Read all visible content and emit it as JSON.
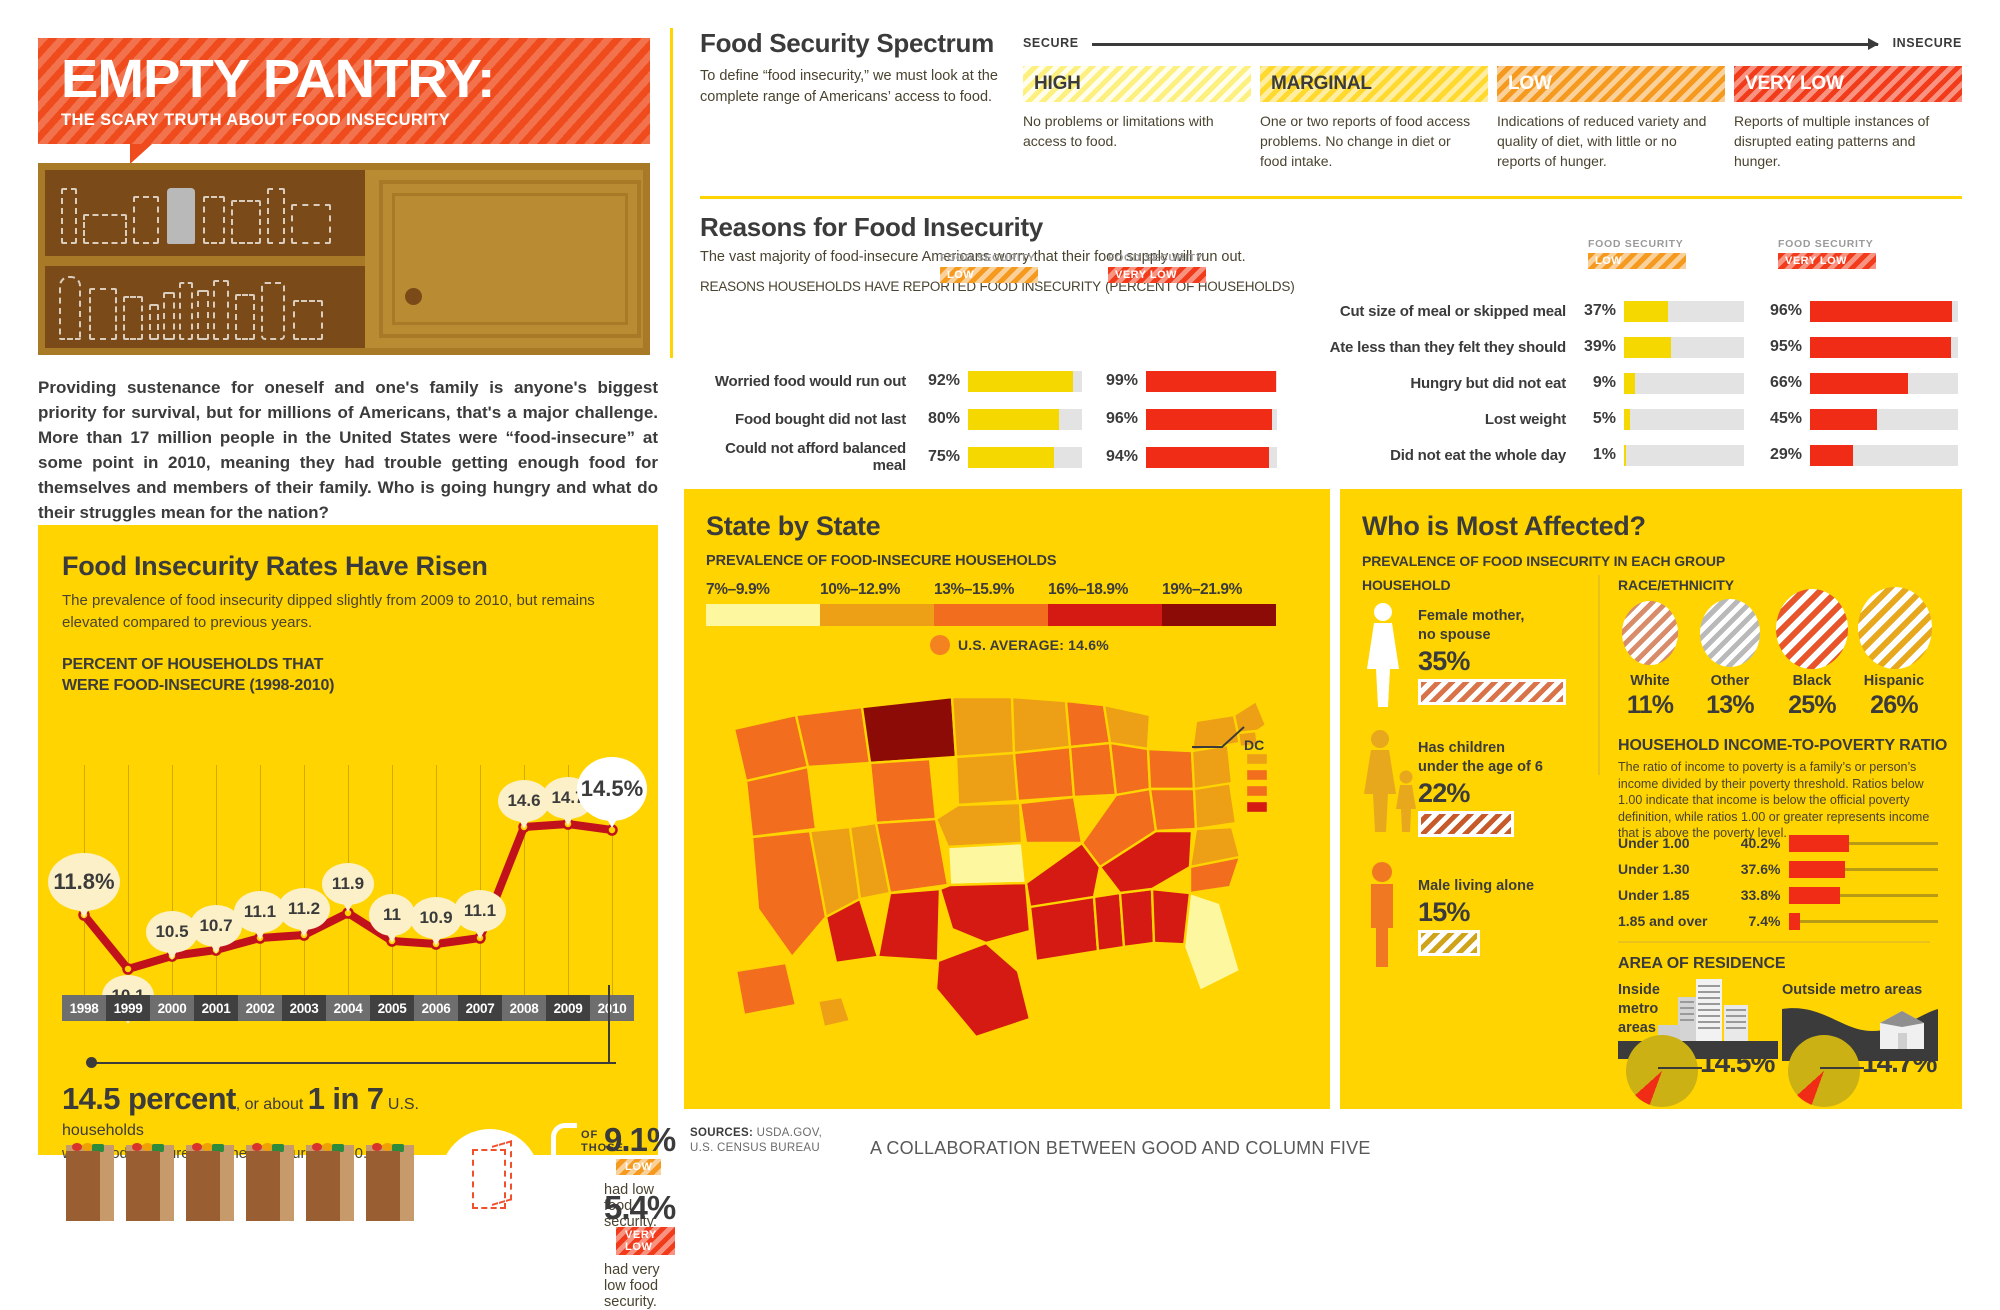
{
  "title": {
    "main": "EMPTY PANTRY:",
    "sub": "THE SCARY TRUTH ABOUT FOOD INSECURITY"
  },
  "intro": "Providing sustenance for oneself and one's family is anyone's biggest priority for survival, but for millions of Americans, that's a major challenge. More than 17 million people in the United States were “food-insecure” at some point in 2010, meaning they had trouble getting enough food for themselves and members of their family. Who is going hungry and what do their struggles mean for the nation?",
  "spectrum": {
    "heading": "Food Security Spectrum",
    "paragraph": "To define “food insecurity,” we must look at the complete range of Americans’ access to food.",
    "secure_label": "SECURE",
    "insecure_label": "INSECURE",
    "cells": [
      {
        "label": "HIGH",
        "desc": "No problems or limitations with access to food.",
        "style": "stripes-yellow-lt",
        "text": "dark"
      },
      {
        "label": "MARGINAL",
        "desc": "One or two reports of food access problems. No change in diet or food intake.",
        "style": "stripes-yellow",
        "text": "dark"
      },
      {
        "label": "LOW",
        "desc": "Indications of reduced variety and quality of diet, with little or no reports of hunger.",
        "style": "stripes-orange",
        "text": "light"
      },
      {
        "label": "VERY LOW",
        "desc": "Reports of multiple instances of disrupted eating patterns and hunger.",
        "style": "stripes-red",
        "text": "light"
      }
    ]
  },
  "reasons": {
    "heading": "Reasons for Food Insecurity",
    "paragraph": "The vast majority of food-insecure Americans worry that their food supply will run out.",
    "kicker": "REASONS HOUSEHOLDS HAVE REPORTED FOOD INSECURITY",
    "kicker_note": "(PERCENT OF HOUSEHOLDS)",
    "legend_caption": "FOOD SECURITY",
    "legend_low": "LOW",
    "legend_very_low": "VERY LOW",
    "left_rows": [
      {
        "label": "Worried food would run out",
        "low": "92%",
        "low_v": 92,
        "vlow": "99%",
        "vlow_v": 99
      },
      {
        "label": "Food bought did not last",
        "low": "80%",
        "low_v": 80,
        "vlow": "96%",
        "vlow_v": 96
      },
      {
        "label": "Could not afford balanced meal",
        "low": "75%",
        "low_v": 75,
        "vlow": "94%",
        "vlow_v": 94
      }
    ],
    "right_rows": [
      {
        "label": "Cut size of meal or skipped meal",
        "low": "37%",
        "low_v": 37,
        "vlow": "96%",
        "vlow_v": 96
      },
      {
        "label": "Ate less than they felt they should",
        "low": "39%",
        "low_v": 39,
        "vlow": "95%",
        "vlow_v": 95
      },
      {
        "label": "Hungry but did not eat",
        "low": "9%",
        "low_v": 9,
        "vlow": "66%",
        "vlow_v": 66
      },
      {
        "label": "Lost weight",
        "low": "5%",
        "low_v": 5,
        "vlow": "45%",
        "vlow_v": 45
      },
      {
        "label": "Did not eat the whole day",
        "low": "1%",
        "low_v": 1,
        "vlow": "29%",
        "vlow_v": 29
      }
    ]
  },
  "rates": {
    "heading": "Food Insecurity Rates Have Risen",
    "sub": "The prevalence of food insecurity dipped slightly from 2009 to 2010, but remains elevated compared to previous years.",
    "kicker_line1": "PERCENT OF HOUSEHOLDS THAT",
    "kicker_line2": "WERE FOOD-INSECURE (1998-2010)",
    "bigstat_pct": "14.5 percent",
    "bigstat_mid": ", or about ",
    "bigstat_ratio": "1 in 7",
    "bigstat_tail": " U.S. households",
    "bigstat_line2": "were food-insecure at some time during 2010.",
    "of_those": "OF THOSE",
    "sub_low_pct": "9.1%",
    "sub_low_tag": "LOW",
    "sub_low_cap": "had low food security.",
    "sub_vlow_pct": "5.4%",
    "sub_vlow_tag": "VERY LOW",
    "sub_vlow_cap": "had very low food security."
  },
  "map": {
    "heading": "State by State",
    "kicker": "PREVALENCE OF FOOD-INSECURE HOUSEHOLDS",
    "legend_labels": [
      "7%–9.9%",
      "10%–12.9%",
      "13%–15.9%",
      "16%–18.9%",
      "19%–21.9%"
    ],
    "legend_colors": [
      "#fdf7a0",
      "#eda016",
      "#f26d1e",
      "#d41a12",
      "#8c0b07"
    ],
    "average_label": "U.S. AVERAGE: 14.6%",
    "dc_label": "DC"
  },
  "affected": {
    "heading": "Who is Most Affected?",
    "kicker": "PREVALENCE OF FOOD INSECURITY IN EACH GROUP",
    "household_heading": "HOUSEHOLD",
    "households": [
      {
        "label_l1": "Female mother,",
        "label_l2": "no spouse",
        "pct": "35%",
        "pct_v": 35,
        "color": "#d9744a"
      },
      {
        "label_l1": "Has children",
        "label_l2": "under the age of 6",
        "pct": "22%",
        "pct_v": 22,
        "color": "#c75a2a"
      },
      {
        "label_l1": "Male living alone",
        "label_l2": "",
        "pct": "15%",
        "pct_v": 15,
        "color": "#d0a41a"
      }
    ],
    "race_heading": "RACE/ETHNICITY",
    "race": [
      {
        "name": "White",
        "pct": "11%",
        "pct_v": 11,
        "color": "#d98c6a"
      },
      {
        "name": "Other",
        "pct": "13%",
        "pct_v": 13,
        "color": "#b9b9b9"
      },
      {
        "name": "Black",
        "pct": "25%",
        "pct_v": 25,
        "color": "#e8552a"
      },
      {
        "name": "Hispanic",
        "pct": "26%",
        "pct_v": 26,
        "color": "#e8a81e"
      }
    ],
    "ratio_heading": "HOUSEHOLD INCOME-TO-POVERTY RATIO",
    "ratio_desc": "The ratio of income to poverty is a family’s or person’s income divided by their poverty threshold. Ratios below 1.00 indicate that income is below the official poverty definition, while ratios 1.00 or greater represents income that is above the poverty level.",
    "ratios": [
      {
        "label": "Under 1.00",
        "pct": "40.2%",
        "pct_v": 40.2
      },
      {
        "label": "Under 1.30",
        "pct": "37.6%",
        "pct_v": 37.6
      },
      {
        "label": "Under 1.85",
        "pct": "33.8%",
        "pct_v": 33.8
      },
      {
        "label": "1.85 and over",
        "pct": "7.4%",
        "pct_v": 7.4
      }
    ],
    "residence_heading": "AREA OF RESIDENCE",
    "residence": [
      {
        "label_l1": "Inside",
        "label_l2": "metro",
        "label_l3": "areas",
        "pct": "14.5%"
      },
      {
        "label_l1": "Outside metro areas",
        "label_l2": "",
        "label_l3": "",
        "pct": "14.7%"
      }
    ]
  },
  "footer": {
    "sources_label": "SOURCES:",
    "sources_line1": "USDA.GOV,",
    "sources_line2": "U.S. CENSUS BUREAU",
    "collaboration": "A COLLABORATION BETWEEN GOOD AND COLUMN FIVE"
  },
  "colors": {
    "yellow_panel": "#ffd400",
    "bar_low": "#f5d800",
    "bar_very_low": "#f02b16",
    "tag_low": "#f5a623",
    "tag_very_low": "#f02b16",
    "dark_text": "#3b3b3b"
  },
  "chart_data": [
    {
      "type": "line",
      "title": "PERCENT OF HOUSEHOLDS THAT WERE FOOD-INSECURE (1998-2010)",
      "xlabel": "",
      "ylabel": "Percent of households",
      "categories": [
        "1998",
        "1999",
        "2000",
        "2001",
        "2002",
        "2003",
        "2004",
        "2005",
        "2006",
        "2007",
        "2008",
        "2009",
        "2010"
      ],
      "values": [
        11.8,
        10.1,
        10.5,
        10.7,
        11.1,
        11.2,
        11.9,
        11,
        10.9,
        11.1,
        14.6,
        14.7,
        14.5
      ],
      "labels": [
        "11.8%",
        "10.1",
        "10.5",
        "10.7",
        "11.1",
        "11.2",
        "11.9",
        "11",
        "10.9",
        "11.1",
        "14.6",
        "14.7",
        "14.5%"
      ],
      "ylim": [
        9.5,
        15.2
      ],
      "grid": true,
      "legend": "none"
    },
    {
      "type": "bar",
      "title": "REASONS HOUSEHOLDS HAVE REPORTED FOOD INSECURITY (PERCENT OF HOUSEHOLDS)",
      "orientation": "horizontal",
      "categories": [
        "Worried food would run out",
        "Food bought did not last",
        "Could not afford balanced meal",
        "Cut size of meal or skipped meal",
        "Ate less than they felt they should",
        "Hungry but did not eat",
        "Lost weight",
        "Did not eat the whole day"
      ],
      "series": [
        {
          "name": "Food security: LOW",
          "color": "#f5d800",
          "values": [
            92,
            80,
            75,
            37,
            39,
            9,
            5,
            1
          ]
        },
        {
          "name": "Food security: VERY LOW",
          "color": "#f02b16",
          "values": [
            99,
            96,
            94,
            96,
            95,
            66,
            45,
            29
          ]
        }
      ],
      "xlim": [
        0,
        100
      ],
      "legend": "top"
    },
    {
      "type": "bar",
      "title": "HOUSEHOLD INCOME-TO-POVERTY RATIO",
      "orientation": "horizontal",
      "categories": [
        "Under 1.00",
        "Under 1.30",
        "Under 1.85",
        "1.85 and over"
      ],
      "values": [
        40.2,
        37.6,
        33.8,
        7.4
      ],
      "xlim": [
        0,
        100
      ],
      "color": "#f02b16"
    },
    {
      "type": "bar",
      "title": "PREVALENCE OF FOOD INSECURITY IN EACH GROUP — RACE/ETHNICITY",
      "categories": [
        "White",
        "Other",
        "Black",
        "Hispanic"
      ],
      "values": [
        11,
        13,
        25,
        26
      ],
      "ylim": [
        0,
        30
      ]
    },
    {
      "type": "bar",
      "title": "PREVALENCE OF FOOD INSECURITY IN EACH GROUP — HOUSEHOLD",
      "categories": [
        "Female mother, no spouse",
        "Has children under the age of 6",
        "Male living alone"
      ],
      "values": [
        35,
        22,
        15
      ],
      "ylim": [
        0,
        40
      ]
    },
    {
      "type": "heatmap",
      "title": "PREVALENCE OF FOOD-INSECURE HOUSEHOLDS (STATE BY STATE MAP)",
      "bins": [
        "7%–9.9%",
        "10%–12.9%",
        "13%–15.9%",
        "16%–18.9%",
        "19%–21.9%"
      ],
      "bin_colors": [
        "#fdf7a0",
        "#eda016",
        "#f26d1e",
        "#d41a12",
        "#8c0b07"
      ],
      "annotation": "U.S. AVERAGE: 14.6%"
    },
    {
      "type": "pie",
      "title": "AREA OF RESIDENCE",
      "slices": [
        {
          "name": "Inside metro areas",
          "value": 14.5
        },
        {
          "name": "Outside metro areas",
          "value": 14.7
        }
      ]
    }
  ]
}
